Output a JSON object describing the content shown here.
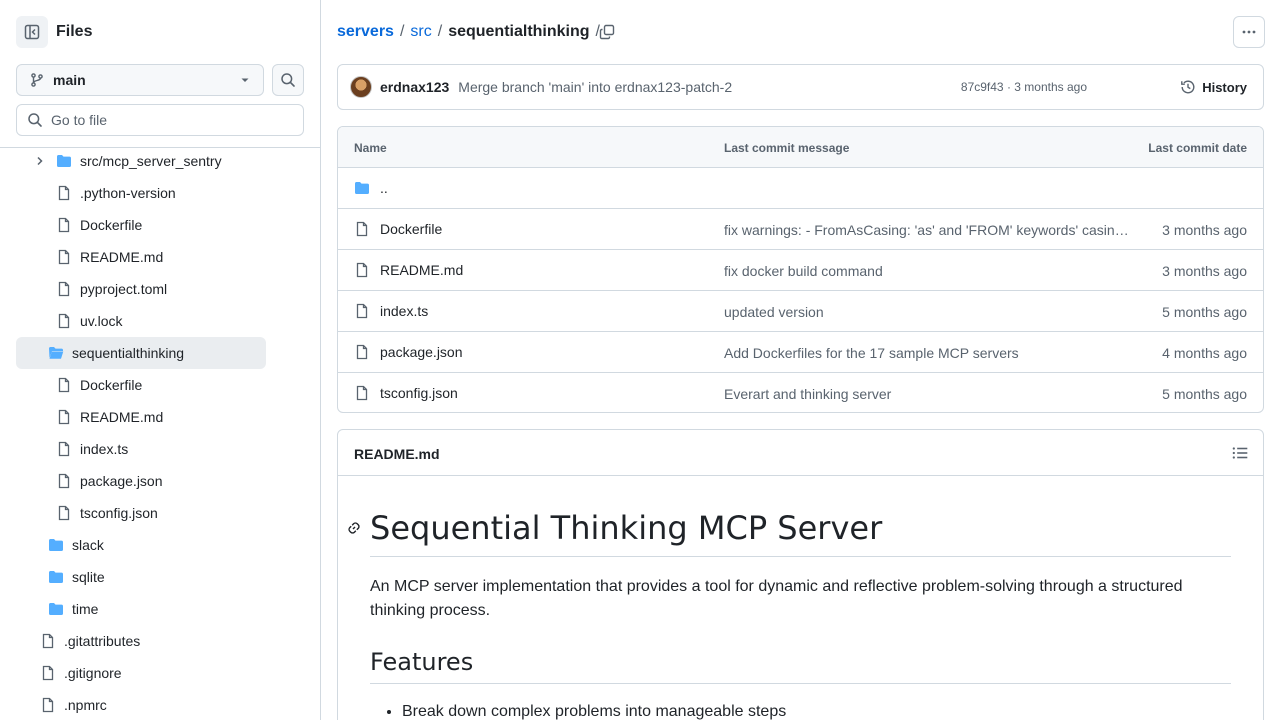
{
  "sidebar": {
    "title": "Files",
    "branch": "main",
    "goto_placeholder": "Go to file",
    "tree": [
      {
        "label": "src/mcp_server_sentry",
        "type": "folder",
        "chevron": true
      },
      {
        "label": ".python-version",
        "type": "file"
      },
      {
        "label": "Dockerfile",
        "type": "file"
      },
      {
        "label": "README.md",
        "type": "file"
      },
      {
        "label": "pyproject.toml",
        "type": "file"
      },
      {
        "label": "uv.lock",
        "type": "file"
      },
      {
        "label": "sequentialthinking",
        "type": "folder-open",
        "active": true
      },
      {
        "label": "Dockerfile",
        "type": "file"
      },
      {
        "label": "README.md",
        "type": "file"
      },
      {
        "label": "index.ts",
        "type": "file"
      },
      {
        "label": "package.json",
        "type": "file"
      },
      {
        "label": "tsconfig.json",
        "type": "file"
      },
      {
        "label": "slack",
        "type": "folder"
      },
      {
        "label": "sqlite",
        "type": "folder"
      },
      {
        "label": "time",
        "type": "folder"
      },
      {
        "label": ".gitattributes",
        "type": "file"
      },
      {
        "label": ".gitignore",
        "type": "file"
      },
      {
        "label": ".npmrc",
        "type": "file"
      }
    ]
  },
  "breadcrumb": {
    "root": "servers",
    "mid": "src",
    "current": "sequentialthinking",
    "sep": "/"
  },
  "commit": {
    "author": "erdnax123",
    "message": "Merge branch 'main' into erdnax123-patch-2",
    "meta": "87c9f43 · 3 months ago",
    "history_label": "History"
  },
  "files_table": {
    "headers": {
      "name": "Name",
      "message": "Last commit message",
      "date": "Last commit date"
    },
    "parent": "..",
    "rows": [
      {
        "name": "Dockerfile",
        "message": "fix warnings: - FromAsCasing: 'as' and 'FROM' keywords' casing do not match",
        "date": "3 months ago"
      },
      {
        "name": "README.md",
        "message": "fix docker build command",
        "date": "3 months ago"
      },
      {
        "name": "index.ts",
        "message": "updated version",
        "date": "5 months ago"
      },
      {
        "name": "package.json",
        "message": "Add Dockerfiles for the 17 sample MCP servers",
        "date": "4 months ago"
      },
      {
        "name": "tsconfig.json",
        "message": "Everart and thinking server",
        "date": "5 months ago"
      }
    ]
  },
  "readme": {
    "file_label": "README.md",
    "h1": "Sequential Thinking MCP Server",
    "intro": "An MCP server implementation that provides a tool for dynamic and reflective problem-solving through a structured thinking process.",
    "h2": "Features",
    "bullets": [
      "Break down complex problems into manageable steps"
    ]
  },
  "colors": {
    "link": "#0969da",
    "folder": "#54aeff",
    "muted": "#59636e",
    "border": "#d1d9e0"
  }
}
